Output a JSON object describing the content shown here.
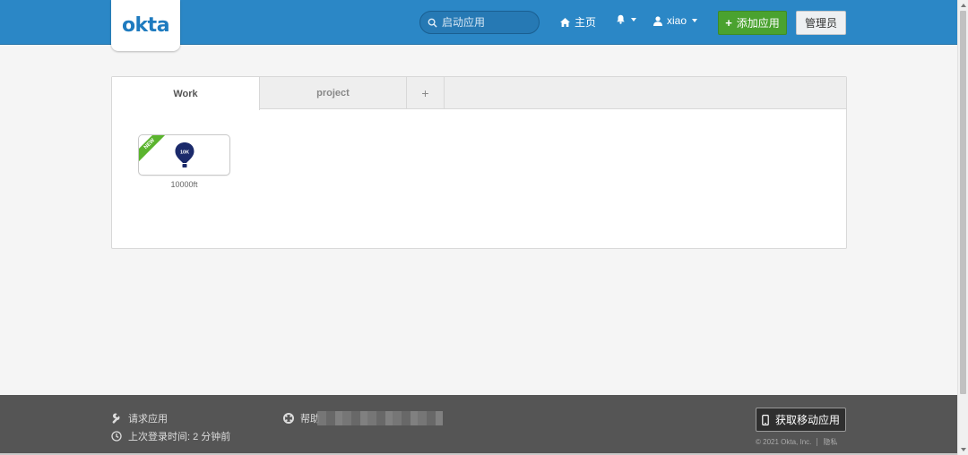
{
  "header": {
    "logo_text": "okta",
    "search_placeholder": "启动应用",
    "nav_home": "主页",
    "user_name": "xiao",
    "add_app_label": "添加应用",
    "admin_label": "管理员"
  },
  "tabs": [
    {
      "label": "Work",
      "active": true
    },
    {
      "label": "project",
      "active": false
    },
    {
      "label": "+",
      "active": false
    }
  ],
  "apps": [
    {
      "name": "10000ft",
      "badge": "NEW",
      "icon_text": "10K"
    }
  ],
  "footer": {
    "request_app": "请求应用",
    "last_login": "上次登录时间: 2 分钟前",
    "help": "帮助",
    "get_mobile_app": "获取移动应用",
    "copyright": "© 2021 Okta, Inc.",
    "privacy": "隐私"
  },
  "colors": {
    "header_bg": "#2b87c6",
    "add_button": "#4aa22f",
    "footer_bg": "#555555",
    "new_badge": "#5bb42e"
  }
}
